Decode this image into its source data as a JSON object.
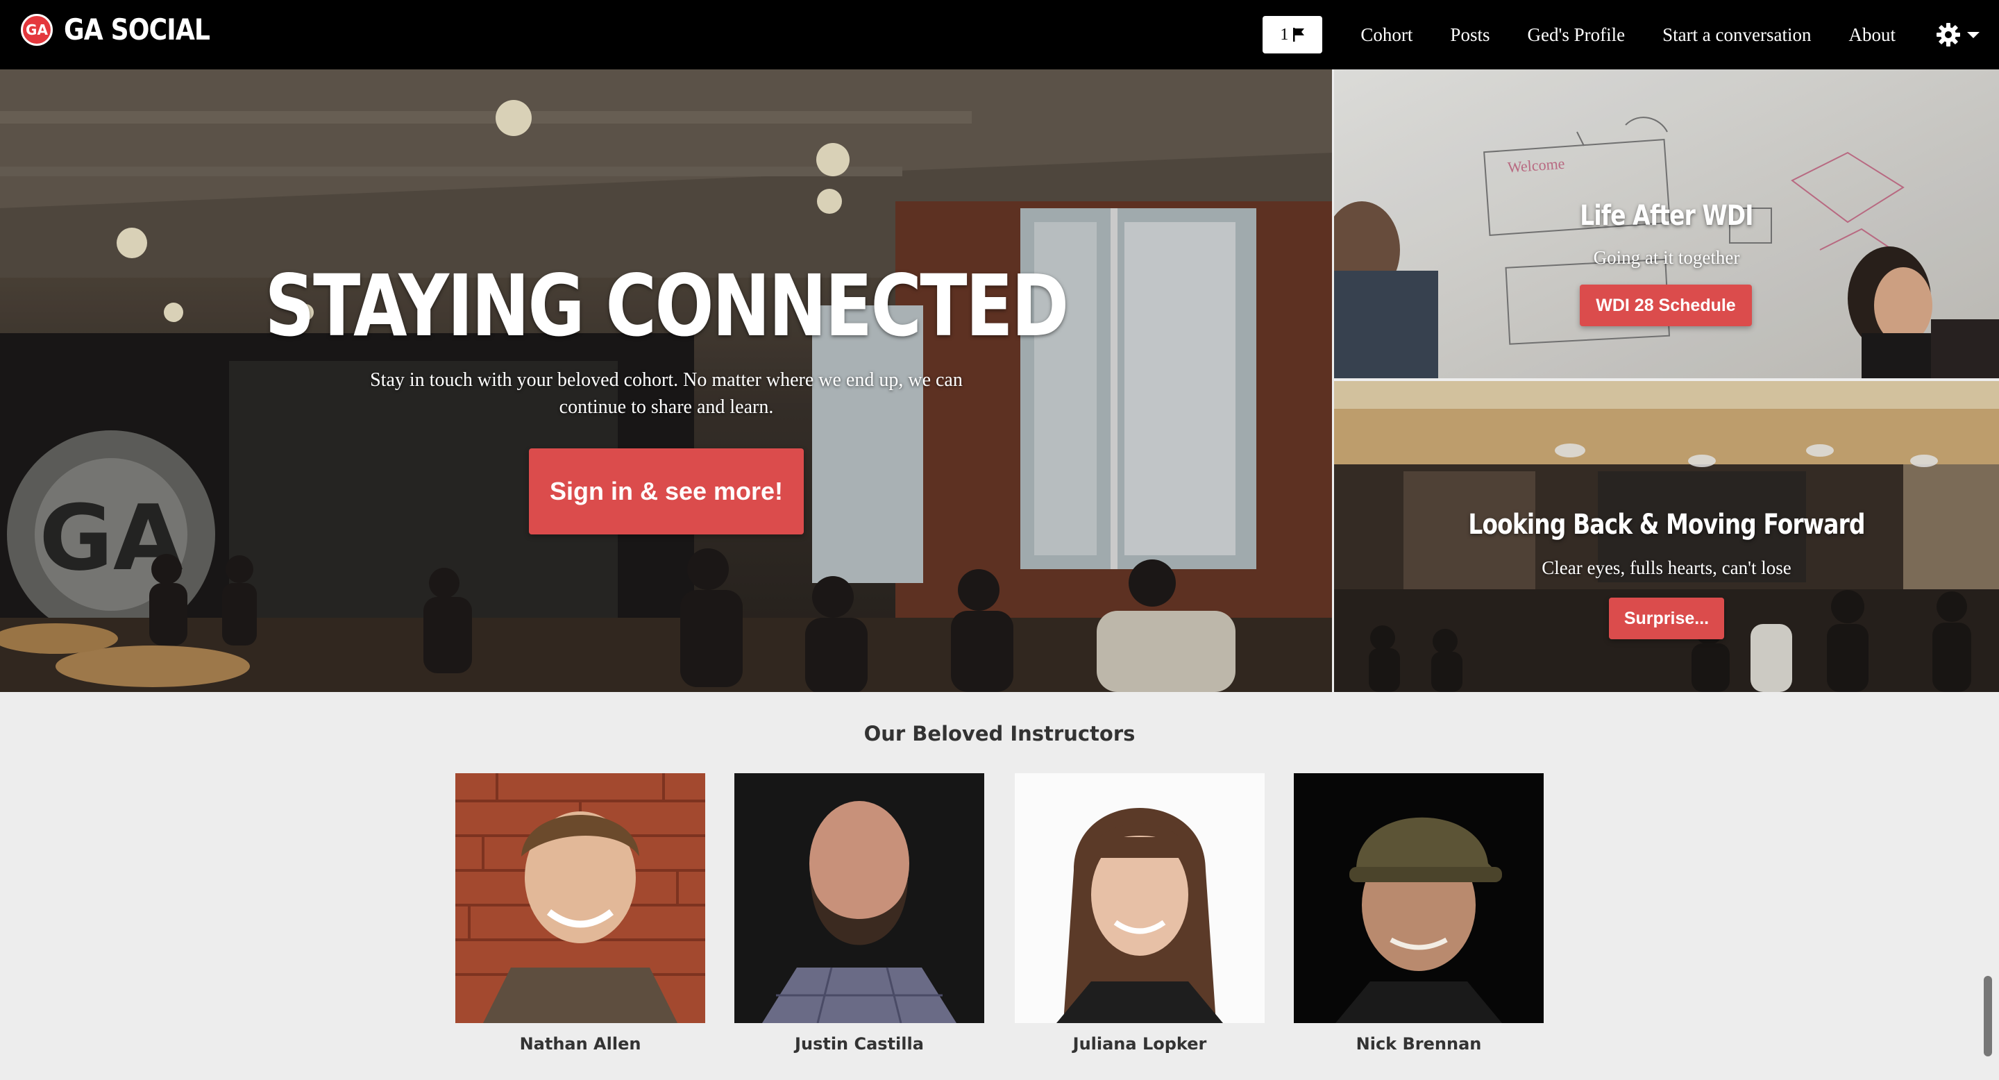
{
  "navbar": {
    "logo_text": "GA",
    "brand": "GA SOCIAL",
    "notification_count": "1",
    "links": [
      "Cohort",
      "Posts",
      "Ged's Profile",
      "Start a conversation",
      "About"
    ]
  },
  "hero": {
    "main": {
      "title": "STAYING CONNECTED",
      "subtitle": "Stay in touch with your beloved cohort. No matter where we end up, we can continue to share and learn.",
      "button": "Sign in & see more!",
      "wall_logo": "GA"
    },
    "side_top": {
      "title": "Life After WDI",
      "subtitle": "Going at it together",
      "button": "WDI 28 Schedule"
    },
    "side_bottom": {
      "title": "Looking Back & Moving Forward",
      "subtitle": "Clear eyes, fulls hearts, can't lose",
      "button": "Surprise..."
    }
  },
  "instructors": {
    "heading": "Our Beloved Instructors",
    "people": [
      {
        "name": "Nathan Allen"
      },
      {
        "name": "Justin Castilla"
      },
      {
        "name": "Juliana Lopker"
      },
      {
        "name": "Nick Brennan"
      }
    ]
  },
  "colors": {
    "accent": "#db4c4c",
    "navbar_bg": "#000000",
    "page_bg": "#ededed"
  },
  "icons": [
    "flag-icon",
    "gear-icon",
    "caret-down-icon"
  ]
}
